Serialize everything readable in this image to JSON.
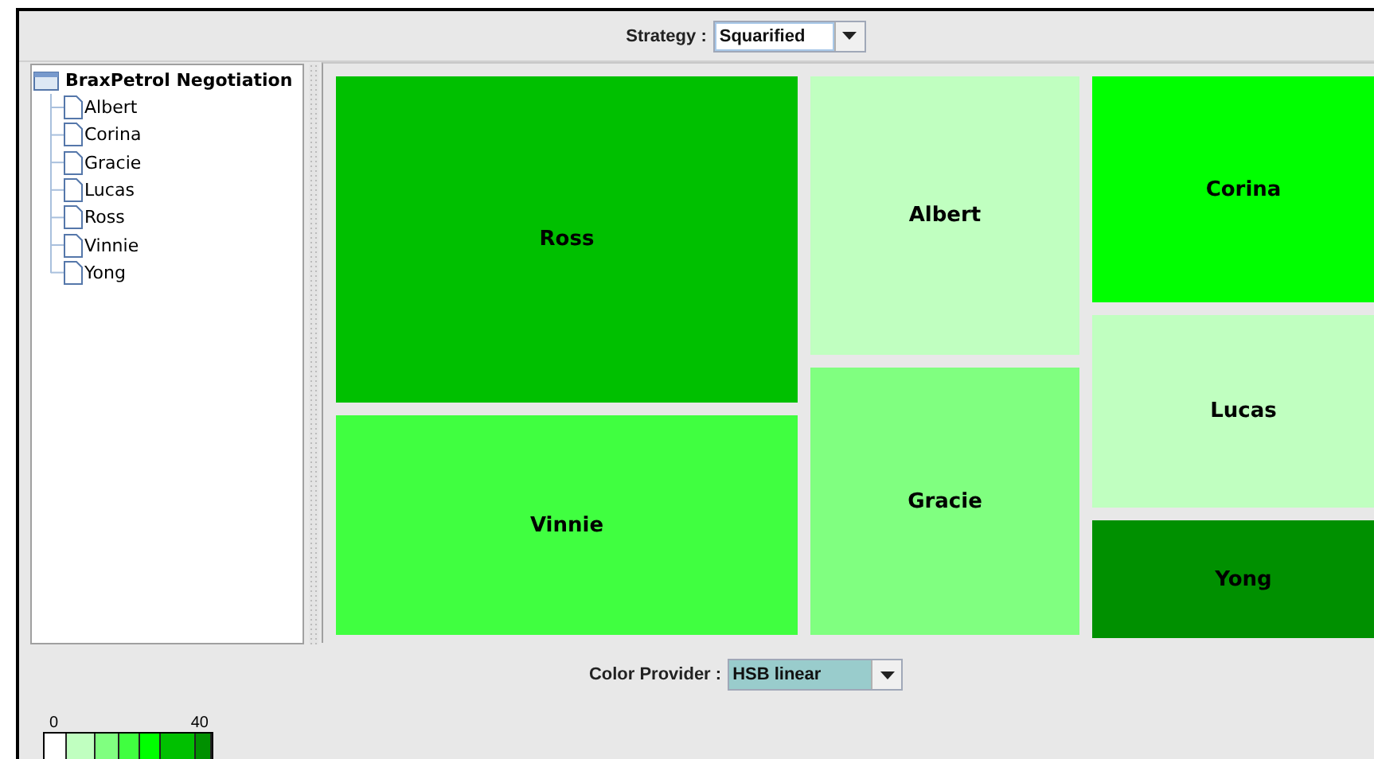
{
  "strategy": {
    "label": "Strategy :",
    "value": "Squarified"
  },
  "tree": {
    "label": "BraxPetrol Negotiation",
    "children": [
      {
        "label": "Albert"
      },
      {
        "label": "Corina"
      },
      {
        "label": "Gracie"
      },
      {
        "label": "Lucas"
      },
      {
        "label": "Ross"
      },
      {
        "label": "Vinnie"
      },
      {
        "label": "Yong"
      }
    ]
  },
  "treemap": {
    "columns": [
      {
        "cells": [
          {
            "label": "Ross",
            "color": "#00c000"
          },
          {
            "label": "Vinnie",
            "color": "#40ff40"
          }
        ]
      },
      {
        "cells": [
          {
            "label": "Albert",
            "color": "#c0ffc0"
          },
          {
            "label": "Gracie",
            "color": "#80ff80"
          }
        ]
      },
      {
        "cells": [
          {
            "label": "Corina",
            "color": "#00ff00"
          },
          {
            "label": "Lucas",
            "color": "#c0ffc0"
          },
          {
            "label": "Yong",
            "color": "#009000"
          }
        ]
      }
    ]
  },
  "color_provider": {
    "label": "Color Provider :",
    "value": "HSB linear"
  },
  "legend": {
    "min": "0",
    "max": "40",
    "swatches": [
      {
        "color": "#ffffff"
      },
      {
        "color": "#c0ffc0"
      },
      {
        "color": "#80ff80"
      },
      {
        "color": "#40ff40"
      },
      {
        "color": "#00ff00"
      },
      {
        "color": "#00c000"
      },
      {
        "color": "#009000"
      }
    ]
  }
}
